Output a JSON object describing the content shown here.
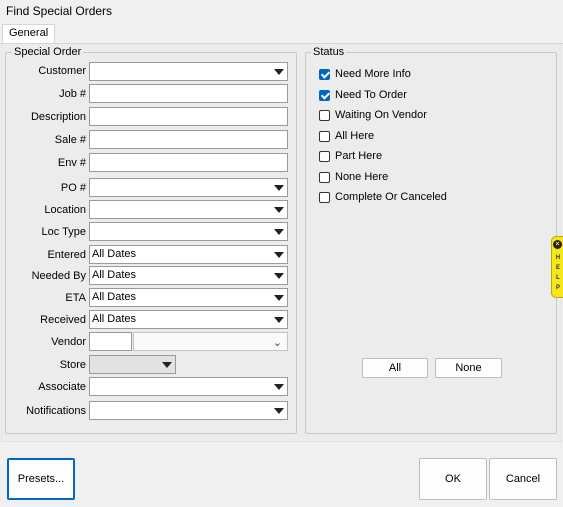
{
  "window": {
    "title": "Find Special Orders"
  },
  "tabs": [
    {
      "label": "General"
    }
  ],
  "special_order": {
    "legend": "Special Order",
    "fields": {
      "customer": {
        "label": "Customer",
        "value": ""
      },
      "job": {
        "label": "Job #",
        "value": ""
      },
      "description": {
        "label": "Description",
        "value": ""
      },
      "sale": {
        "label": "Sale #",
        "value": ""
      },
      "env": {
        "label": "Env #",
        "value": ""
      },
      "po": {
        "label": "PO #",
        "value": ""
      },
      "location": {
        "label": "Location",
        "value": ""
      },
      "loc_type": {
        "label": "Loc Type",
        "value": ""
      },
      "entered": {
        "label": "Entered",
        "value": "All Dates"
      },
      "needed_by": {
        "label": "Needed By",
        "value": "All Dates"
      },
      "eta": {
        "label": "ETA",
        "value": "All Dates"
      },
      "received": {
        "label": "Received",
        "value": "All Dates"
      },
      "vendor": {
        "label": "Vendor",
        "code": "",
        "value": ""
      },
      "store": {
        "label": "Store",
        "value": ""
      },
      "associate": {
        "label": "Associate",
        "value": ""
      },
      "notifications": {
        "label": "Notifications",
        "value": ""
      }
    }
  },
  "status": {
    "legend": "Status",
    "items": [
      {
        "label": "Need More Info",
        "checked": true
      },
      {
        "label": "Need To Order",
        "checked": true
      },
      {
        "label": "Waiting On Vendor",
        "checked": false
      },
      {
        "label": "All Here",
        "checked": false
      },
      {
        "label": "Part Here",
        "checked": false
      },
      {
        "label": "None Here",
        "checked": false
      },
      {
        "label": "Complete Or Canceled",
        "checked": false
      }
    ],
    "all_label": "All",
    "none_label": "None"
  },
  "help_tab": {
    "icon": "close-icon",
    "text": "HELP"
  },
  "footer": {
    "presets_label": "Presets...",
    "ok_label": "OK",
    "cancel_label": "Cancel"
  },
  "colors": {
    "accent": "#0067c0",
    "help_bg": "#f5e71b"
  }
}
